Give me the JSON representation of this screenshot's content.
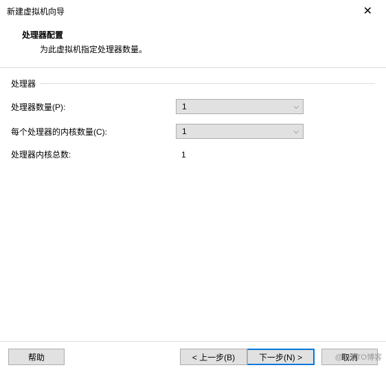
{
  "window": {
    "title": "新建虚拟机向导"
  },
  "header": {
    "title": "处理器配置",
    "subtitle": "为此虚拟机指定处理器数量。"
  },
  "group": {
    "label": "处理器"
  },
  "fields": {
    "processors": {
      "label": "处理器数量(P):",
      "value": "1"
    },
    "cores": {
      "label": "每个处理器的内核数量(C):",
      "value": "1"
    },
    "total": {
      "label": "处理器内核总数:",
      "value": "1"
    }
  },
  "footer": {
    "help": "帮助",
    "prev": "< 上一步(B)",
    "next": "下一步(N) >",
    "cancel": "取消"
  },
  "watermark": "@51CTO博客"
}
